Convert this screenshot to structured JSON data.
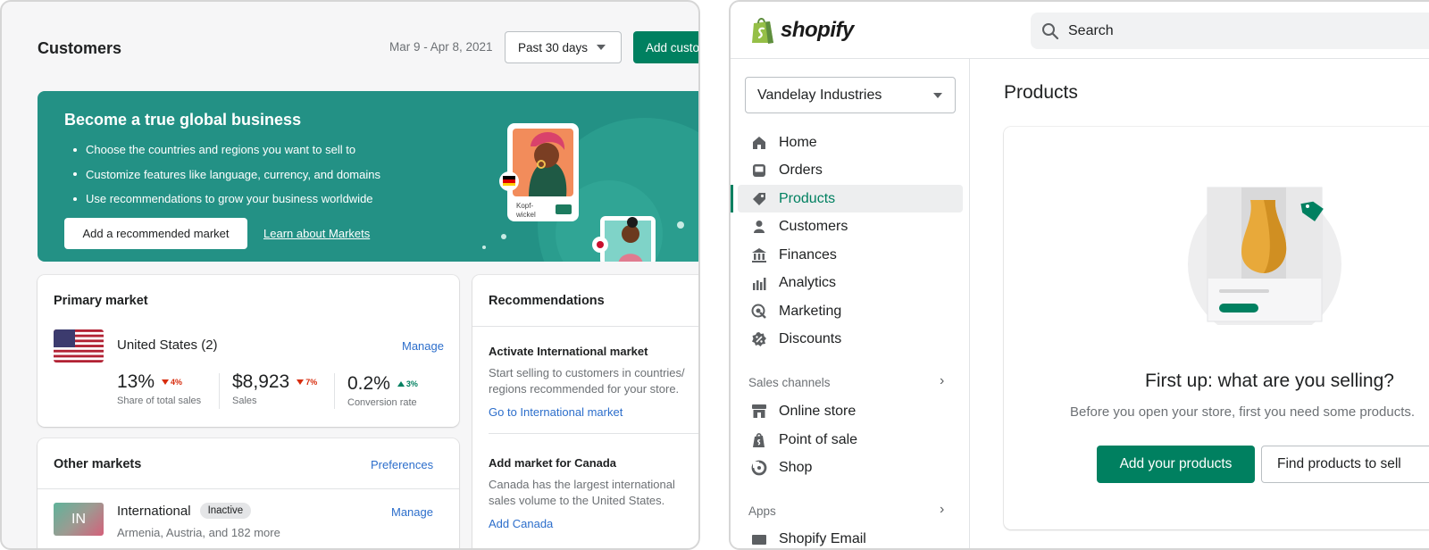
{
  "customers": {
    "title": "Customers",
    "date_range": "Mar 9 - Apr 8, 2021",
    "range_select": "Past 30 days",
    "add_button": "Add customer",
    "banner": {
      "title": "Become a true global business",
      "bullets": [
        "Choose the countries and regions you want to sell to",
        "Customize features like language, currency, and domains",
        "Use recommendations to grow your business worldwide"
      ],
      "primary_button": "Add a recommended market",
      "link": "Learn about Markets",
      "illustration_caption": "Kopf-\nwickel"
    },
    "primary_market": {
      "title": "Primary market",
      "country": "United States (2)",
      "manage": "Manage",
      "metrics": [
        {
          "value": "13%",
          "delta": "4%",
          "direction": "down",
          "label": "Share of total sales"
        },
        {
          "value": "$8,923",
          "delta": "7%",
          "direction": "down",
          "label": "Sales"
        },
        {
          "value": "0.2%",
          "delta": "3%",
          "direction": "up",
          "label": "Conversion rate"
        }
      ]
    },
    "other_markets": {
      "title": "Other markets",
      "preferences": "Preferences",
      "market_code": "IN",
      "market_name": "International",
      "status": "Inactive",
      "manage": "Manage",
      "subtitle": "Armenia, Austria, and 182 more"
    },
    "recommendations": {
      "title": "Recommendations",
      "items": [
        {
          "heading": "Activate International market",
          "body": "Start selling to customers in countries/ regions recommended for your store.",
          "link": "Go to International market"
        },
        {
          "heading": "Add market for Canada",
          "body": "Canada has the largest international sales volume to the United States.",
          "link": "Add Canada"
        }
      ]
    }
  },
  "admin": {
    "brand": "shopify",
    "search_placeholder": "Search",
    "store_name": "Vandelay Industries",
    "nav": [
      {
        "label": "Home",
        "icon": "home-icon"
      },
      {
        "label": "Orders",
        "icon": "orders-icon"
      },
      {
        "label": "Products",
        "icon": "tag-icon"
      },
      {
        "label": "Customers",
        "icon": "person-icon"
      },
      {
        "label": "Finances",
        "icon": "bank-icon"
      },
      {
        "label": "Analytics",
        "icon": "bar-chart-icon"
      },
      {
        "label": "Marketing",
        "icon": "target-icon"
      },
      {
        "label": "Discounts",
        "icon": "discount-icon"
      }
    ],
    "active_nav": "Products",
    "sales_channels_label": "Sales channels",
    "channels": [
      {
        "label": "Online store",
        "icon": "store-icon"
      },
      {
        "label": "Point of sale",
        "icon": "pos-icon"
      },
      {
        "label": "Shop",
        "icon": "shop-icon"
      }
    ],
    "apps_label": "Apps",
    "apps": [
      {
        "label": "Shopify Email",
        "icon": "email-icon"
      }
    ],
    "page_title": "Products",
    "empty_heading": "First up: what are you selling?",
    "empty_sub": "Before you open your store, first you need some products.",
    "add_products": "Add your products",
    "find_products": "Find products to sell"
  },
  "colors": {
    "accent": "#008060",
    "banner": "#239185",
    "link": "#2c6ecb",
    "critical": "#d72c0d"
  }
}
